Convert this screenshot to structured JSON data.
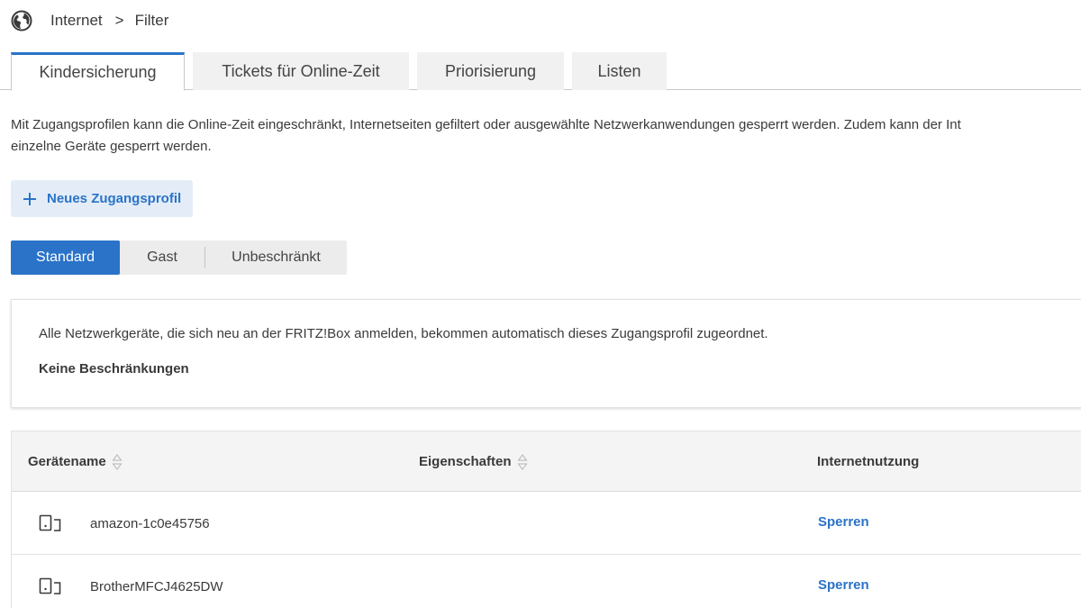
{
  "breadcrumb": {
    "icon": "globe-icon",
    "items": [
      "Internet",
      "Filter"
    ],
    "separator": ">"
  },
  "tabs": [
    {
      "label": "Kindersicherung",
      "active": true
    },
    {
      "label": "Tickets für Online-Zeit",
      "active": false
    },
    {
      "label": "Priorisierung",
      "active": false
    },
    {
      "label": "Listen",
      "active": false
    }
  ],
  "description": {
    "line1": "Mit Zugangsprofilen kann die Online-Zeit eingeschränkt, Internetseiten gefiltert oder ausgewählte Netzwerkanwendungen gesperrt werden. Zudem kann der Int",
    "line2": "einzelne Geräte gesperrt werden."
  },
  "new_profile_button": {
    "icon": "plus-icon",
    "label": "Neues Zugangsprofil"
  },
  "profiles": [
    {
      "label": "Standard",
      "active": true
    },
    {
      "label": "Gast",
      "active": false
    },
    {
      "label": "Unbeschränkt",
      "active": false
    }
  ],
  "profile_info": {
    "text": "Alle Netzwerkgeräte, die sich neu an der FRITZ!Box anmelden, bekommen automatisch dieses Zugangsprofil zugeordnet.",
    "restriction": "Keine Beschränkungen"
  },
  "table": {
    "columns": [
      {
        "label": "Gerätename",
        "sortable": true
      },
      {
        "label": "Eigenschaften",
        "sortable": true
      },
      {
        "label": "Internetnutzung",
        "sortable": false
      }
    ],
    "rows": [
      {
        "icon": "device-icon",
        "name": "amazon-1c0e45756",
        "action": "Sperren"
      },
      {
        "icon": "device-icon",
        "name": "BrotherMFCJ4625DW",
        "action": "Sperren"
      }
    ]
  },
  "colors": {
    "accent": "#2a73c8",
    "accent_light": "#e4edf7"
  }
}
